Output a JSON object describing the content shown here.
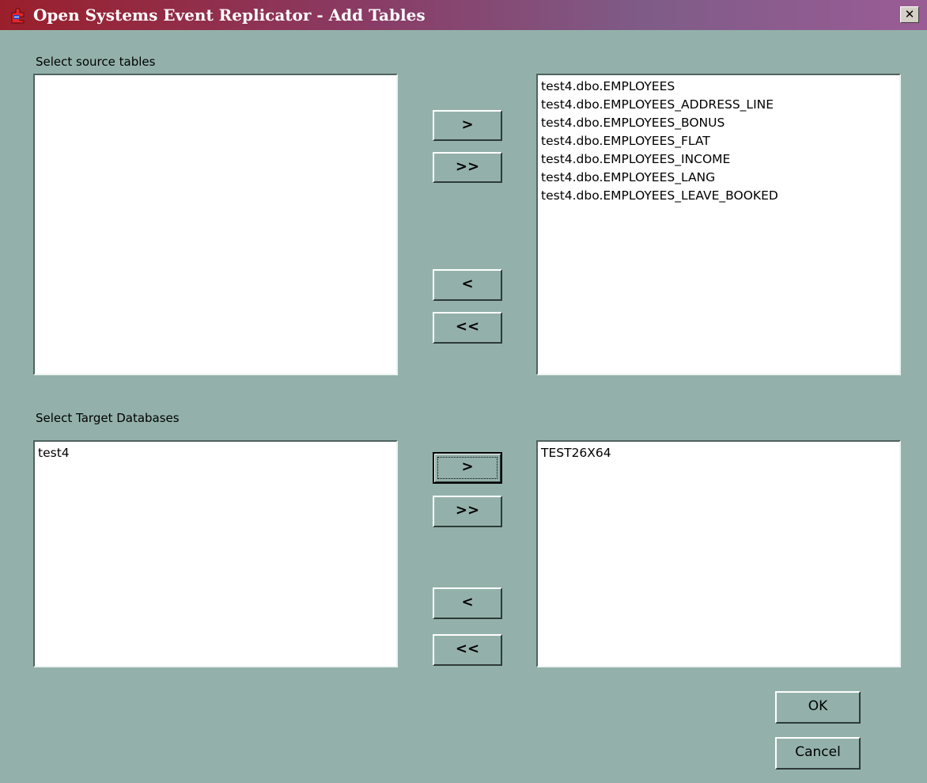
{
  "window": {
    "title": "Open Systems Event Replicator - Add Tables",
    "close_label": "✕"
  },
  "source_tables": {
    "label": "Select source tables",
    "available_items": [],
    "selected_items": [
      "test4.dbo.EMPLOYEES",
      "test4.dbo.EMPLOYEES_ADDRESS_LINE",
      "test4.dbo.EMPLOYEES_BONUS",
      "test4.dbo.EMPLOYEES_FLAT",
      "test4.dbo.EMPLOYEES_INCOME",
      "test4.dbo.EMPLOYEES_LANG",
      "test4.dbo.EMPLOYEES_LEAVE_BOOKED"
    ],
    "buttons": {
      "add": ">",
      "add_all": ">>",
      "remove": "<",
      "remove_all": "<<"
    }
  },
  "target_databases": {
    "label": "Select Target Databases",
    "available_items": [
      "test4"
    ],
    "selected_items": [
      "TEST26X64"
    ],
    "buttons": {
      "add": ">",
      "add_all": ">>",
      "remove": "<",
      "remove_all": "<<"
    }
  },
  "footer": {
    "ok_label": "OK",
    "cancel_label": "Cancel"
  },
  "colors": {
    "dialog_background": "#93b1aa",
    "title_gradient_start": "#9a1f2b",
    "title_gradient_end": "#9a5c95",
    "listbox_background": "#ffffff"
  },
  "icons": {
    "app_icon": "puzzle-app-icon",
    "close_icon": "close-icon"
  }
}
